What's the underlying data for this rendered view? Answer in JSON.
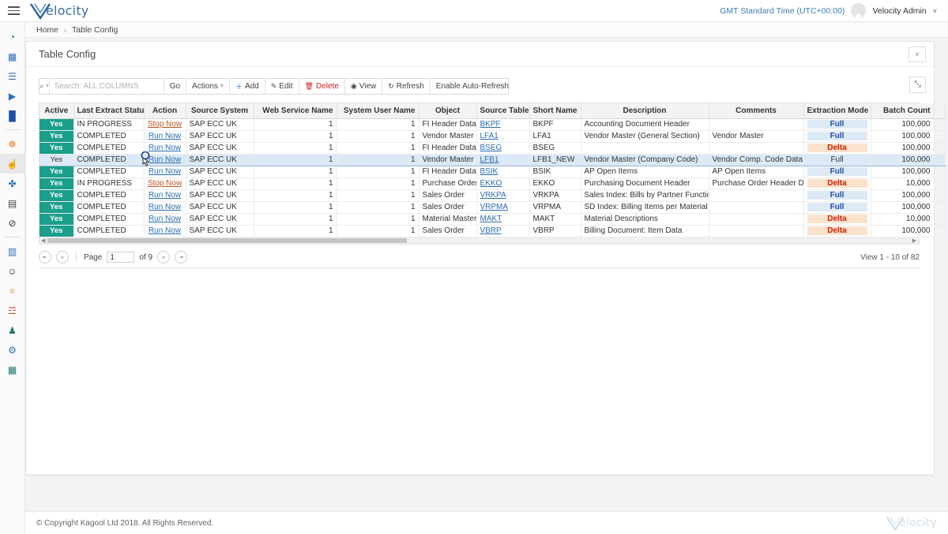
{
  "app": {
    "brand_name": "elocity",
    "brand_mark": "V",
    "timezone": "GMT Standard Time (UTC+00:00)",
    "user_name": "Velocity Admin",
    "user_caret": "˅"
  },
  "breadcrumb": {
    "home": "Home",
    "separator": "›",
    "current": "Table Config"
  },
  "sidebar": {
    "items": [
      {
        "name": "dashboard-icon",
        "glyph": "◔",
        "color": "#1f7a68",
        "active": false
      },
      {
        "name": "apps-grid-icon",
        "glyph": "▦",
        "color": "#2f6fb5",
        "active": false
      },
      {
        "name": "server-stack-icon",
        "glyph": "☰",
        "color": "#2f6fb5",
        "active": false
      },
      {
        "name": "play-icon",
        "glyph": "▶",
        "color": "#2f6fb5",
        "active": false
      },
      {
        "name": "bar-chart-icon",
        "glyph": "█",
        "color": "#1f4fa8",
        "active": false
      },
      {
        "name": "share-nodes-icon",
        "glyph": "☸",
        "color": "#e08a4a",
        "active": false
      },
      {
        "name": "hand-pointer-icon",
        "glyph": "☝",
        "color": "#555555",
        "active": true
      },
      {
        "name": "molecule-icon",
        "glyph": "✤",
        "color": "#2f6fb5",
        "active": false
      },
      {
        "name": "calendar-icon",
        "glyph": "▤",
        "color": "#444444",
        "active": false
      },
      {
        "name": "block-icon",
        "glyph": "⊘",
        "color": "#333333",
        "active": false
      },
      {
        "name": "table-window-icon",
        "glyph": "▥",
        "color": "#2f6fb5",
        "active": false
      },
      {
        "name": "add-user-icon",
        "glyph": "☺",
        "color": "#333333",
        "active": false
      },
      {
        "name": "list-lines-icon",
        "glyph": "≡",
        "color": "#d9a45b",
        "active": false
      },
      {
        "name": "sliders-icon",
        "glyph": "☲",
        "color": "#c0533c",
        "active": false
      },
      {
        "name": "users-group-icon",
        "glyph": "♟",
        "color": "#1f7a68",
        "active": false
      },
      {
        "name": "gears-icon",
        "glyph": "⚙",
        "color": "#2f6fb5",
        "active": false
      },
      {
        "name": "grid-table-icon",
        "glyph": "▦",
        "color": "#1f7a68",
        "active": false
      }
    ]
  },
  "card": {
    "title": "Table Config",
    "collapse_glyph": "˅",
    "expand_glyph": "⤡"
  },
  "toolbar": {
    "search_placeholder": "Search: ALL COLUMNS",
    "search_value": "",
    "search_icon": "⌕",
    "search_caret": "˅",
    "go_label": "Go",
    "actions_label": "Actions",
    "actions_caret": "˅",
    "add_label": "Add",
    "add_icon": "＋",
    "edit_label": "Edit",
    "edit_icon": "✎",
    "delete_label": "Delete",
    "delete_icon": "Ὕ1",
    "view_label": "View",
    "view_icon": "◉",
    "refresh_label": "Refresh",
    "refresh_icon": "↻",
    "autorefresh_label": "Enable Auto-Refresh"
  },
  "table": {
    "columns": [
      "Active",
      "Last Extract Status",
      "Action",
      "Source System",
      "Web Service Name",
      "System User Name",
      "Object",
      "Source Table",
      "Short Name",
      "Description",
      "Comments",
      "Extraction Mode",
      "Batch Count"
    ],
    "rows": [
      {
        "active": "Yes",
        "status": "IN PROGRESS",
        "action": "Stop Now",
        "action_kind": "stop",
        "source_system": "SAP ECC UK",
        "web_service_name": "1",
        "system_user_name": "1",
        "object": "FI Header Data",
        "source_table": "BKPF",
        "short_name": "BKPF",
        "description": "Accounting Document Header",
        "comments": "",
        "extraction_mode": "Full",
        "batch_count": "100,000",
        "selected": false
      },
      {
        "active": "Yes",
        "status": "COMPLETED",
        "action": "Run Now",
        "action_kind": "run",
        "source_system": "SAP ECC UK",
        "web_service_name": "1",
        "system_user_name": "1",
        "object": "Vendor Master",
        "source_table": "LFA1",
        "short_name": "LFA1",
        "description": "Vendor Master (General Section)",
        "comments": "Vendor Master",
        "extraction_mode": "Full",
        "batch_count": "100,000",
        "selected": false
      },
      {
        "active": "Yes",
        "status": "COMPLETED",
        "action": "Run Now",
        "action_kind": "run",
        "source_system": "SAP ECC UK",
        "web_service_name": "1",
        "system_user_name": "1",
        "object": "FI Header Data",
        "source_table": "BSEG",
        "short_name": "BSEG",
        "description": "",
        "comments": "",
        "extraction_mode": "Delta",
        "batch_count": "100,000",
        "selected": false
      },
      {
        "active": "Yes",
        "status": "COMPLETED",
        "action": "Run Now",
        "action_kind": "run",
        "source_system": "SAP ECC UK",
        "web_service_name": "1",
        "system_user_name": "1",
        "object": "Vendor Master",
        "source_table": "LFB1",
        "short_name": "LFB1_NEW",
        "description": "Vendor Master (Company Code)",
        "comments": "Vendor Comp. Code Data",
        "extraction_mode": "Full",
        "batch_count": "100,000",
        "selected": true
      },
      {
        "active": "Yes",
        "status": "COMPLETED",
        "action": "Run Now",
        "action_kind": "run",
        "source_system": "SAP ECC UK",
        "web_service_name": "1",
        "system_user_name": "1",
        "object": "FI Header Data",
        "source_table": "BSIK",
        "short_name": "BSIK",
        "description": "AP Open Items",
        "comments": "AP Open Items",
        "extraction_mode": "Full",
        "batch_count": "100,000",
        "selected": false
      },
      {
        "active": "Yes",
        "status": "IN PROGRESS",
        "action": "Stop Now",
        "action_kind": "stop",
        "source_system": "SAP ECC UK",
        "web_service_name": "1",
        "system_user_name": "1",
        "object": "Purchase Order",
        "source_table": "EKKO",
        "short_name": "EKKO",
        "description": "Purchasing Document Header",
        "comments": "Purchase Order Header Data",
        "extraction_mode": "Delta",
        "batch_count": "10,000",
        "selected": false
      },
      {
        "active": "Yes",
        "status": "COMPLETED",
        "action": "Run Now",
        "action_kind": "run",
        "source_system": "SAP ECC UK",
        "web_service_name": "1",
        "system_user_name": "1",
        "object": "Sales Order",
        "source_table": "VRKPA",
        "short_name": "VRKPA",
        "description": "Sales Index: Bills by Partner Functions",
        "comments": "",
        "extraction_mode": "Full",
        "batch_count": "100,000",
        "selected": false
      },
      {
        "active": "Yes",
        "status": "COMPLETED",
        "action": "Run Now",
        "action_kind": "run",
        "source_system": "SAP ECC UK",
        "web_service_name": "1",
        "system_user_name": "1",
        "object": "Sales Order",
        "source_table": "VRPMA",
        "short_name": "VRPMA",
        "description": "SD Index: Billing Items per Material",
        "comments": "",
        "extraction_mode": "Full",
        "batch_count": "100,000",
        "selected": false
      },
      {
        "active": "Yes",
        "status": "COMPLETED",
        "action": "Run Now",
        "action_kind": "run",
        "source_system": "SAP ECC UK",
        "web_service_name": "1",
        "system_user_name": "1",
        "object": "Material Master",
        "source_table": "MAKT",
        "short_name": "MAKT",
        "description": "Material Descriptions",
        "comments": "",
        "extraction_mode": "Delta",
        "batch_count": "10,000",
        "selected": false
      },
      {
        "active": "Yes",
        "status": "COMPLETED",
        "action": "Run Now",
        "action_kind": "run",
        "source_system": "SAP ECC UK",
        "web_service_name": "1",
        "system_user_name": "1",
        "object": "Sales Order",
        "source_table": "VBRP",
        "short_name": "VBRP",
        "description": "Billing Document: Item Data",
        "comments": "",
        "extraction_mode": "Delta",
        "batch_count": "100,000",
        "selected": false
      }
    ]
  },
  "pager": {
    "first_glyph": "⇤",
    "prev_glyph": "«",
    "page_label": "Page",
    "page_value": "1",
    "of_label": "of 9",
    "next_glyph": "»",
    "last_glyph": "⇥",
    "view_label": "View 1 - 10 of 82"
  },
  "footer": {
    "copyright": "© Copyright Kagool Ltd 2018. All Rights Reserved."
  },
  "colors": {
    "accent_teal": "#1a9f8a",
    "link_blue": "#2b6cb0",
    "stop_orange": "#c0531f",
    "full_blue": "#1f4fa8",
    "delta_red": "#cc2200",
    "brand_blue": "#3a6ea5"
  }
}
